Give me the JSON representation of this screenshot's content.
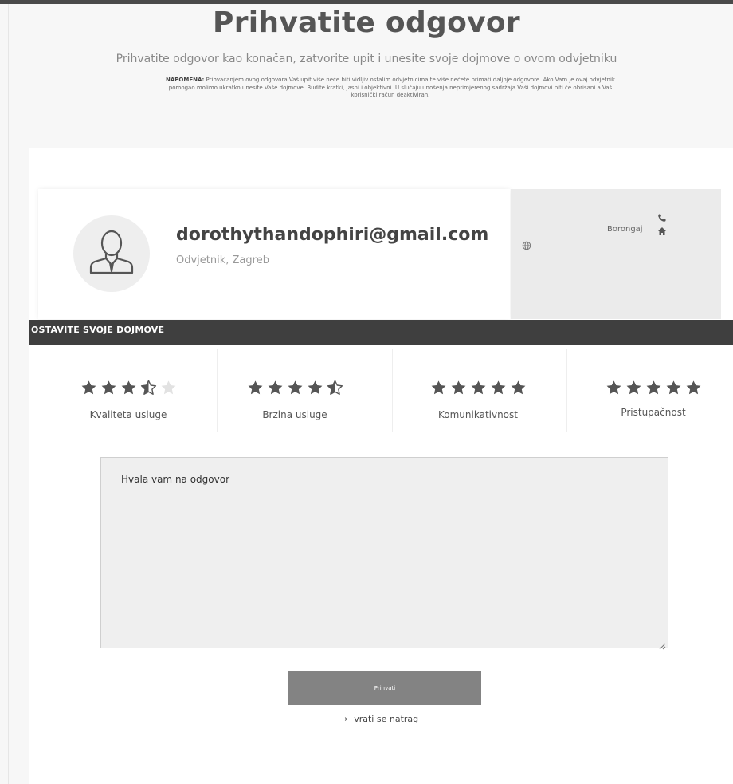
{
  "header": {
    "title": "Prihvatite odgovor",
    "subtitle": "Prihvatite odgovor kao konačan, zatvorite upit i unesite svoje dojmove o ovom odvjetniku",
    "notice_label": "NAPOMENA:",
    "notice_text": " Prihvaćanjem ovog odgovora Vaš upit više neće biti vidljiv ostalim odvjetnicima te više nećete primati daljnje odgovore. Ako Vam je ovaj odvjetnik pomogao molimo ukratko unesite Vaše dojmove. Budite kratki, jasni i objektivni. U slučaju unošenja neprimjerenog sadržaja Vaši dojmovi biti će obrisani a Vaš korisnički račun deaktiviran."
  },
  "lawyer": {
    "name": "dorothythandophiri@gmail.com",
    "role": "Odvjetnik, Zagreb",
    "city": "Borongaj"
  },
  "section_title": "OSTAVITE SVOJE DOJMOVE",
  "ratings": [
    {
      "label": "Kvaliteta usluge",
      "stars": 3.5
    },
    {
      "label": "Brzina usluge",
      "stars": 4.5
    },
    {
      "label": "Komunikativnost",
      "stars": 5
    },
    {
      "label": "Pristupačnost",
      "stars": 5
    }
  ],
  "comment": {
    "value": "Hvala vam na odgovor"
  },
  "accept_button": "Prihvati",
  "back_link": "vrati se natrag",
  "back_arrow": "→",
  "colors": {
    "star_on": "#555555",
    "star_off": "#e2e2e2",
    "section_bar": "#3f3f3f",
    "button": "#838383"
  }
}
